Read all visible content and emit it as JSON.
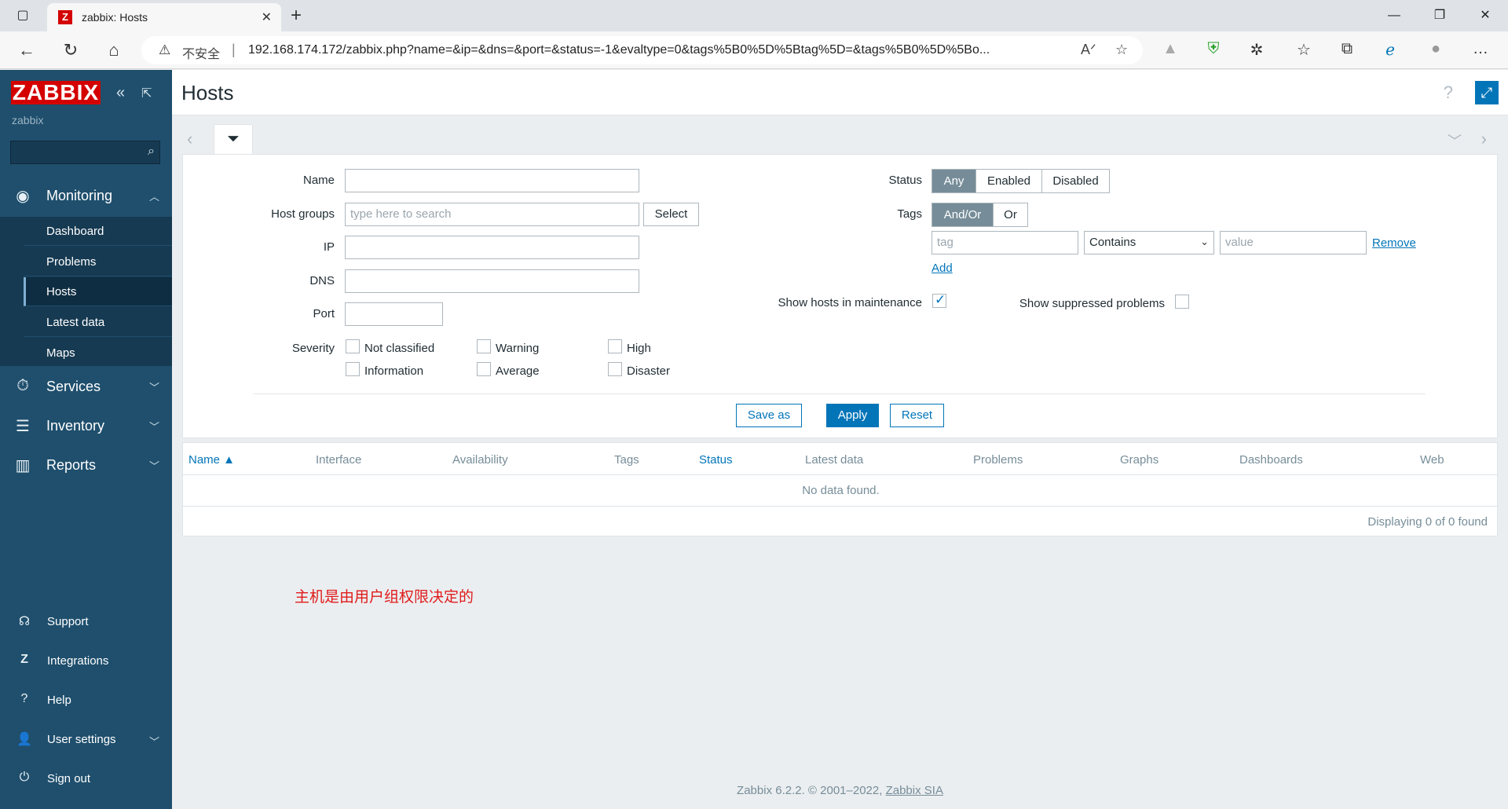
{
  "browser": {
    "tab_title": "zabbix: Hosts",
    "tab_favicon": "Z",
    "security_label": "不安全",
    "url": "192.168.174.172/zabbix.php?name=&ip=&dns=&port=&status=-1&evaltype=0&tags%5B0%5D%5Btag%5D=&tags%5B0%5D%5Bo..."
  },
  "sidebar": {
    "logo": "ZABBIX",
    "instance": "zabbix",
    "search_value": "",
    "monitoring": {
      "label": "Monitoring",
      "items": [
        "Dashboard",
        "Problems",
        "Hosts",
        "Latest data",
        "Maps"
      ],
      "active": "Hosts"
    },
    "sections": [
      "Services",
      "Inventory",
      "Reports"
    ],
    "bottom": [
      "Support",
      "Integrations",
      "Help",
      "User settings",
      "Sign out"
    ]
  },
  "page": {
    "title": "Hosts"
  },
  "filter": {
    "name_label": "Name",
    "hostgroups_label": "Host groups",
    "hostgroups_placeholder": "type here to search",
    "select_label": "Select",
    "ip_label": "IP",
    "dns_label": "DNS",
    "port_label": "Port",
    "severity_label": "Severity",
    "severities": [
      "Not classified",
      "Warning",
      "High",
      "Information",
      "Average",
      "Disaster"
    ],
    "status_label": "Status",
    "status_options": [
      "Any",
      "Enabled",
      "Disabled"
    ],
    "status_selected": "Any",
    "tags_label": "Tags",
    "tags_options": [
      "And/Or",
      "Or"
    ],
    "tags_selected": "And/Or",
    "tag_placeholder": "tag",
    "operator_value": "Contains",
    "value_placeholder": "value",
    "remove_label": "Remove",
    "add_label": "Add",
    "maintenance_label": "Show hosts in maintenance",
    "maintenance_checked": true,
    "suppressed_label": "Show suppressed problems",
    "suppressed_checked": false,
    "save_as_label": "Save as",
    "apply_label": "Apply",
    "reset_label": "Reset"
  },
  "table": {
    "columns": [
      "Name ▲",
      "Interface",
      "Availability",
      "Tags",
      "Status",
      "Latest data",
      "Problems",
      "Graphs",
      "Dashboards",
      "Web"
    ],
    "empty_text": "No data found.",
    "paging_text": "Displaying 0 of 0 found"
  },
  "annotation": "主机是由用户组权限决定的",
  "footer": {
    "text": "Zabbix 6.2.2. © 2001–2022, ",
    "link": "Zabbix SIA"
  },
  "colors": {
    "brand_red": "#d40000",
    "sidebar": "#1f4f6d",
    "accent": "#0275b8",
    "annotation": "#e01b1b"
  }
}
